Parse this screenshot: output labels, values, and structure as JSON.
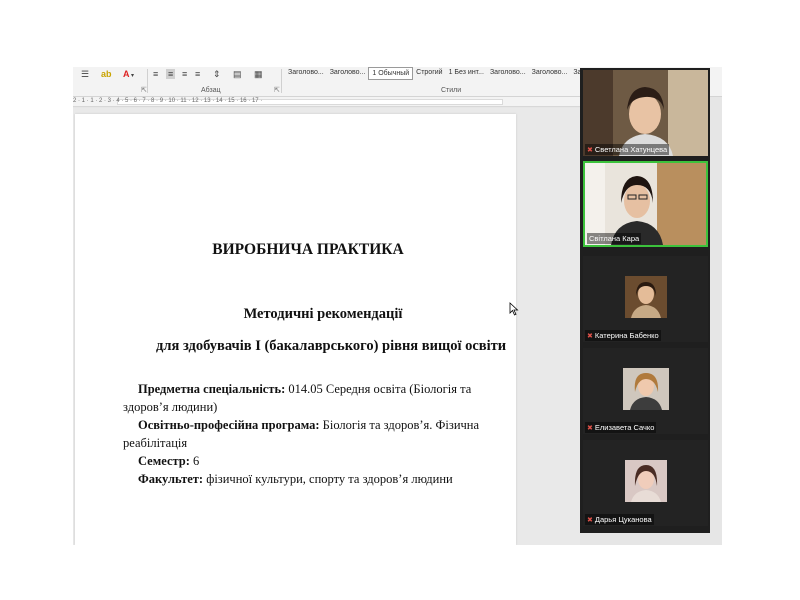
{
  "ribbon": {
    "paragraph_group_label": "Абзац",
    "styles_group_label": "Стили",
    "styles": [
      "Заголово...",
      "Заголово...",
      "1 Обычный",
      "Строгий",
      "1 Без инт...",
      "Заголово...",
      "Заголово...",
      "Заголово..."
    ]
  },
  "ruler": {
    "numbers": "2 · 1 · 1 · 2 · 3 · 4 · 5 · 6 · 7 · 8 · 9 · 10 · 11 · 12 · 13 · 14 · 15 · 16 · 17 ·"
  },
  "document": {
    "title": "ВИРОБНИЧА ПРАКТИКА",
    "subtitle": "Методичні рекомендації",
    "audience": "для здобувачів І (бакалаврського) рівня вищої освіти",
    "fields": [
      {
        "label": "Предметна спеціальність:",
        "value": "014.05 Середня освіта (Біологія та",
        "cont": "здоров’я людини)"
      },
      {
        "label": "Освітньо-професійна програма:",
        "value": "Біологія та здоров’я. Фізична",
        "cont": "реабілітація"
      },
      {
        "label": "Семестр:",
        "value": "6",
        "cont": ""
      },
      {
        "label": "Факультет:",
        "value": "фізичної культури, спорту та здоров’я людини",
        "cont": ""
      }
    ]
  },
  "participants": [
    {
      "name": "Светлана Хатунцева",
      "muted": true
    },
    {
      "name": "Світлана Кара",
      "muted": false
    },
    {
      "name": "Катерина Бабенко",
      "muted": true
    },
    {
      "name": "Елизавета Сачко",
      "muted": true
    },
    {
      "name": "Дарья Цуканова",
      "muted": true
    }
  ],
  "colors": {
    "active_speaker": "#3cc23c",
    "muted_icon": "#e0524a",
    "panel_bg": "#1f1f1f"
  }
}
